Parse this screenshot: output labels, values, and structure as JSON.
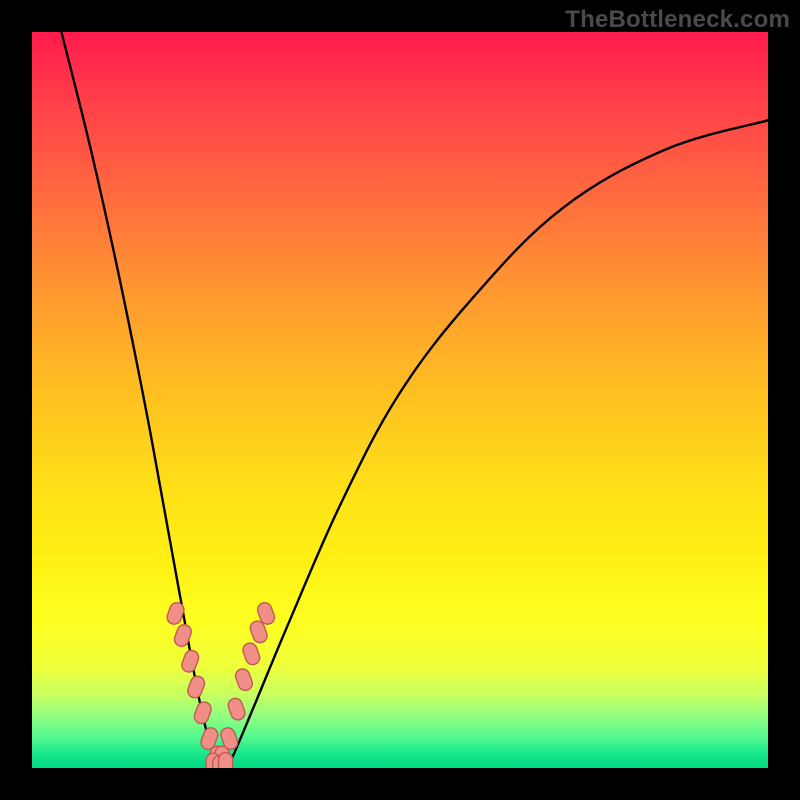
{
  "watermark": "TheBottleneck.com",
  "chart_data": {
    "type": "line",
    "title": "",
    "xlabel": "",
    "ylabel": "",
    "xlim": [
      0,
      100
    ],
    "ylim": [
      0,
      100
    ],
    "background": "gradient red→orange→yellow→green (top→bottom)",
    "series": [
      {
        "name": "main-curve",
        "description": "V-shaped black curve with sharp minimum near x≈25; left branch steep from top-left, right branch rises concave toward upper-right",
        "x": [
          4,
          8,
          12,
          16,
          20,
          23,
          25,
          26,
          27,
          30,
          35,
          42,
          50,
          60,
          72,
          86,
          100
        ],
        "y": [
          100,
          84,
          66,
          46,
          24,
          8,
          1,
          0,
          1,
          8,
          20,
          36,
          51,
          64,
          76,
          84,
          88
        ]
      },
      {
        "name": "markers-left",
        "description": "salmon rounded markers along lower-left branch",
        "x": [
          19.5,
          20.5,
          21.5,
          22.3,
          23.2,
          24.1,
          25.0
        ],
        "y": [
          21,
          18,
          14.5,
          11,
          7.5,
          4,
          1.5
        ]
      },
      {
        "name": "markers-right",
        "description": "salmon rounded markers along lower-right branch",
        "x": [
          26.0,
          26.8,
          27.8,
          28.8,
          29.8,
          30.8,
          31.8
        ],
        "y": [
          1.5,
          4,
          8,
          12,
          15.5,
          18.5,
          21
        ]
      },
      {
        "name": "markers-bottom",
        "description": "cluster of salmon markers at the curve minimum",
        "x": [
          24.6,
          25.5,
          26.3
        ],
        "y": [
          0.5,
          0.2,
          0.6
        ]
      }
    ],
    "colors": {
      "curve": "#000000",
      "marker_fill": "#ef8f87",
      "marker_stroke": "#c05a52",
      "gradient_top": "#ff1a4d",
      "gradient_bottom": "#00d880",
      "frame": "#000000"
    }
  }
}
